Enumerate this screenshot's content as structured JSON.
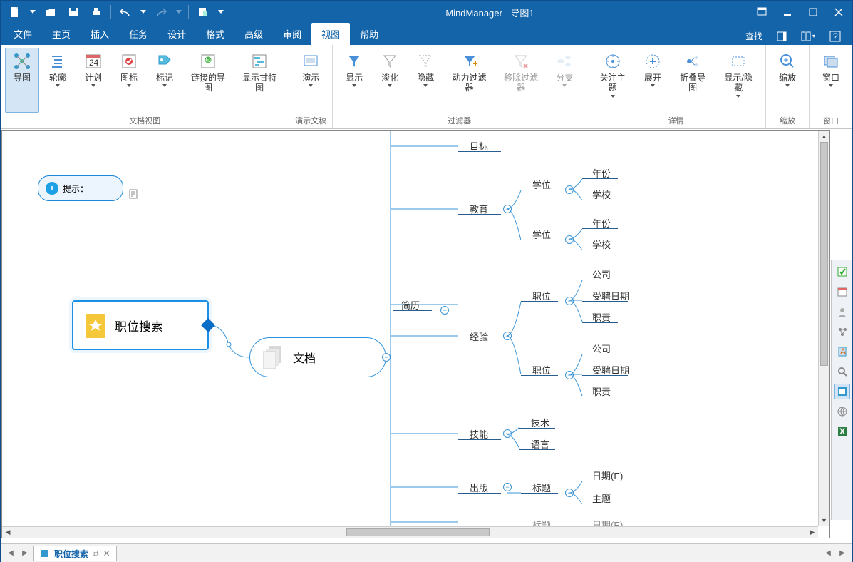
{
  "app": {
    "title": "MindManager - 导图1"
  },
  "menu": {
    "items": [
      "文件",
      "主页",
      "插入",
      "任务",
      "设计",
      "格式",
      "高级",
      "审阅",
      "视图",
      "帮助"
    ],
    "active": 8,
    "find": "查找"
  },
  "ribbon": {
    "group1": {
      "name": "文档视图",
      "btns": [
        "导图",
        "轮廓",
        "计划",
        "图标",
        "标记",
        "链接的导图",
        "显示甘特图"
      ]
    },
    "group2": {
      "name": "演示文稿",
      "btns": [
        "演示"
      ]
    },
    "group3": {
      "name": "过滤器",
      "btns": [
        "显示",
        "淡化",
        "隐藏",
        "动力过滤器",
        "移除过滤器",
        "分支"
      ]
    },
    "group4": {
      "name": "详情",
      "btns": [
        "关注主题",
        "展开",
        "折叠导图",
        "显示/隐藏"
      ]
    },
    "group5": {
      "name": "缩放",
      "btns": [
        "缩放"
      ]
    },
    "group6": {
      "name": "窗口",
      "btns": [
        "窗口"
      ]
    }
  },
  "canvas": {
    "hint": "提示：",
    "root": "职位搜索",
    "docNode": "文档",
    "l2": [
      "目标",
      "教育",
      "简历",
      "经验",
      "技能",
      "出版"
    ],
    "edu_children": [
      "学位",
      "学位"
    ],
    "degree_children": [
      "年份",
      "学校"
    ],
    "resume_marker": "简历",
    "exp_children": [
      "职位",
      "职位"
    ],
    "job_children": [
      "公司",
      "受聘日期",
      "职责"
    ],
    "skill_children": [
      "技术",
      "语言"
    ],
    "pub_children": [
      "标题"
    ],
    "title_children": [
      "日期(E)",
      "主题"
    ],
    "truncated": [
      "标题",
      "日期(E)"
    ]
  },
  "tabs": {
    "name": "职位搜索"
  }
}
